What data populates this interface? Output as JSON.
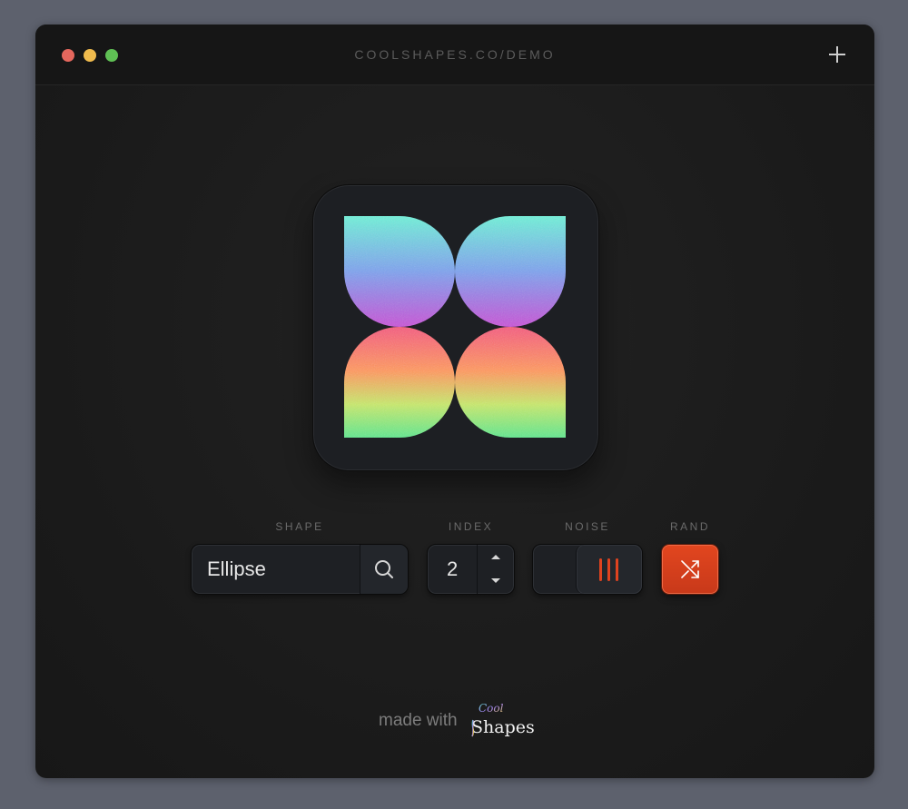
{
  "window": {
    "url": "COOLSHAPES.CO/DEMO",
    "new_tab_icon": "plus-icon"
  },
  "preview": {
    "shape_name": "Ellipse",
    "colors": {
      "teal": "#6ee7d7",
      "blue": "#7fa6ec",
      "magenta": "#c653d8",
      "coral": "#f25f79",
      "orange": "#ff9a5a",
      "lime": "#98f07a",
      "green": "#5be68d"
    }
  },
  "controls": {
    "shape": {
      "label": "SHAPE",
      "value": "Ellipse",
      "search_icon": "search-icon"
    },
    "index": {
      "label": "INDEX",
      "value": "2",
      "up_icon": "chevron-up-icon",
      "down_icon": "chevron-down-icon"
    },
    "noise": {
      "label": "NOISE",
      "enabled": true
    },
    "rand": {
      "label": "RAND",
      "icon": "shuffle-icon"
    }
  },
  "footer": {
    "made_with": "made with",
    "logo_cool": "Cool",
    "logo_shapes": "Shapes"
  },
  "accent": "#e0431f"
}
